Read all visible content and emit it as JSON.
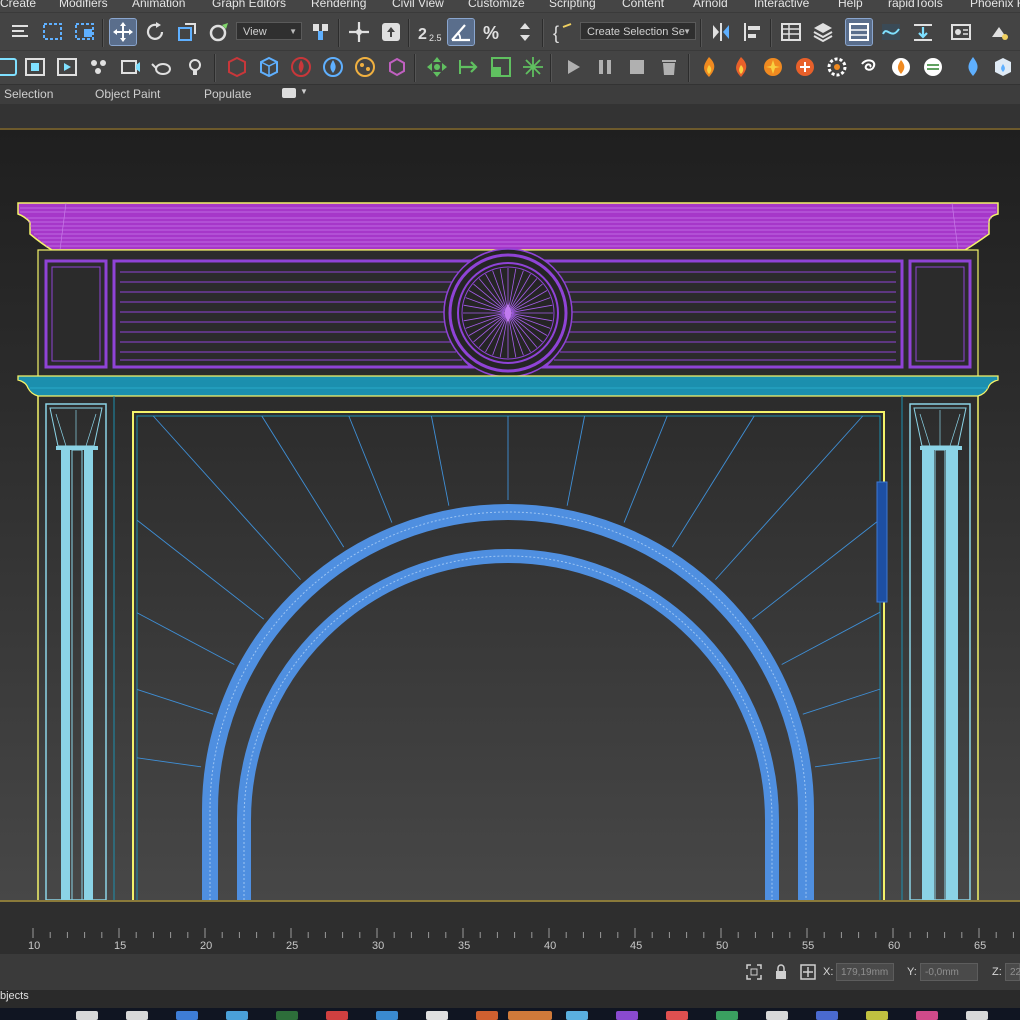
{
  "menu": {
    "items": [
      "Create",
      "Modifiers",
      "Animation",
      "Graph Editors",
      "Rendering",
      "Civil View",
      "Customize",
      "Scripting",
      "Content",
      "Arnold",
      "Interactive",
      "Help",
      "rapidTools",
      "Phoenix F"
    ]
  },
  "toolbar": {
    "view_dropdown": "View",
    "selection_set_dropdown": "Create Selection Se",
    "snap_angle_label": "2.5"
  },
  "ribbon": {
    "tabs": [
      "Selection",
      "Object Paint",
      "Populate"
    ]
  },
  "timeline": {
    "ticks": [
      "10",
      "15",
      "20",
      "25",
      "30",
      "35",
      "40",
      "45",
      "50",
      "55",
      "60",
      "65"
    ]
  },
  "status": {
    "x_label": "X:",
    "x_value": "179,19mm",
    "y_label": "Y:",
    "y_value": "-0,0mm",
    "z_label": "Z:",
    "z_value": "22"
  },
  "prompt": {
    "text": "bjects"
  },
  "colors": {
    "cornice": "#a637c9",
    "panel": "#8f43d6",
    "ledge": "#1b8fae",
    "column": "#8bd3e6",
    "arch": "#4f8fe0",
    "opening_outline": "#f0f060",
    "selection_blue": "#1d4fa3"
  },
  "icons": {
    "toolbar_row1": [
      "menu-lines-icon",
      "select-region-icon",
      "select-move-icon",
      "rotate-icon",
      "scale-icon",
      "link-icon",
      "mirror-icon",
      "align-icon",
      "snap-icon",
      "angle-snap-icon",
      "percent-snap-icon",
      "spinner-snap-icon",
      "curly-brace-icon",
      "layer-icon",
      "explorer-icon",
      "curve-editor-icon",
      "material-icon",
      "render-setup-icon",
      "render-frame-icon"
    ],
    "toolbar_row2": [
      "viewport-icon",
      "render-icon",
      "play-icon",
      "pause-icon",
      "stop-icon",
      "trash-icon",
      "fire-icon",
      "water-drop-icon",
      "cube-icon"
    ]
  }
}
